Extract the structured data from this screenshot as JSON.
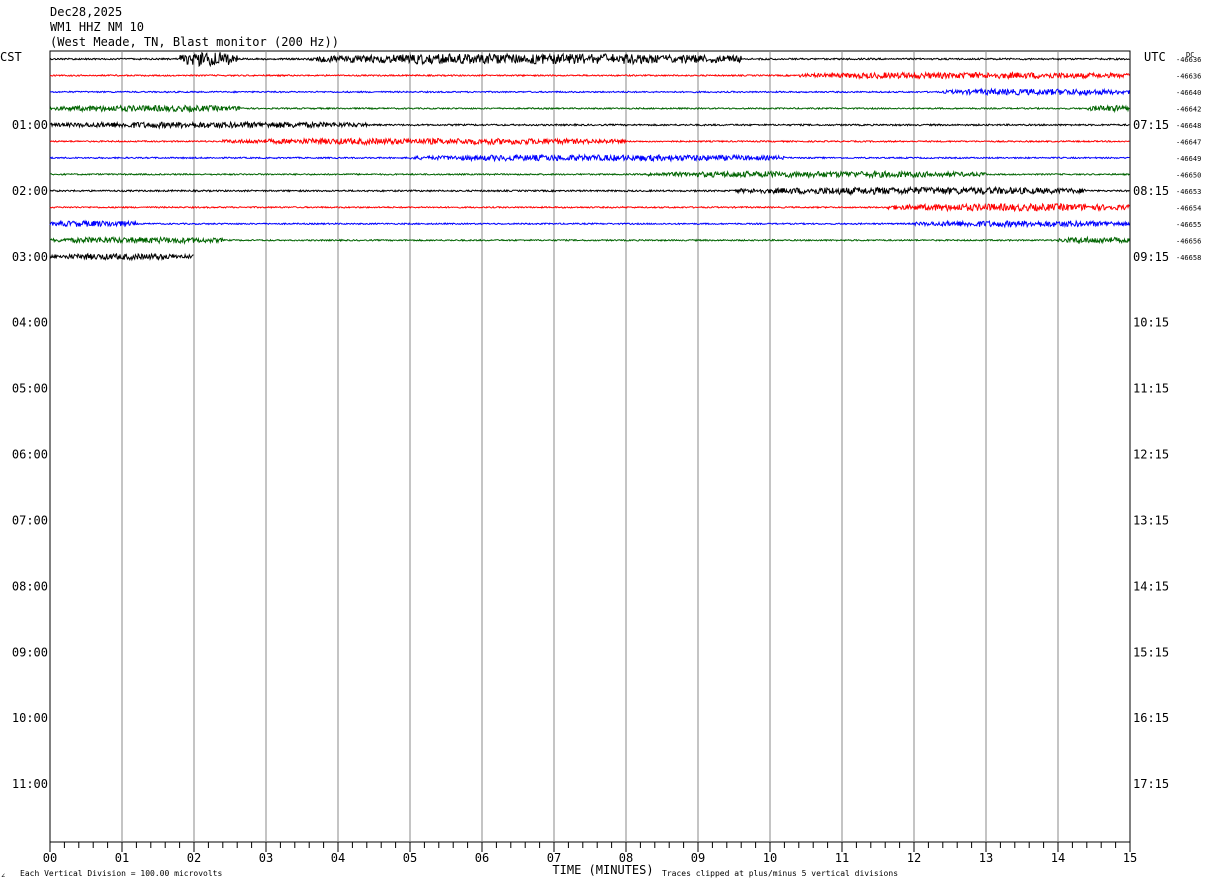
{
  "header": {
    "date": "Dec28,2025",
    "station": "WM1 HHZ NM 10",
    "location": "(West Meade, TN, Blast monitor (200 Hz))"
  },
  "labels": {
    "left_tz": "CST",
    "right_tz": "UTC",
    "dc_header": "DC",
    "xlabel": "TIME (MINUTES)",
    "scale_note": "Each Vertical Division =  100.00 microvolts",
    "clip_note": "Traces clipped at plus/minus 5 vertical divisions",
    "corner_mark": "∠"
  },
  "chart_data": {
    "type": "line",
    "title": "WM1 HHZ NM 10",
    "xlabel": "TIME (MINUTES)",
    "xlim": [
      0,
      15
    ],
    "x_ticks": [
      "00",
      "01",
      "02",
      "03",
      "04",
      "05",
      "06",
      "07",
      "08",
      "09",
      "10",
      "11",
      "12",
      "13",
      "14",
      "15"
    ],
    "row_minutes": 15,
    "total_rows": 48,
    "left_hour_labels": [
      "01:00",
      "02:00",
      "03:00",
      "04:00",
      "05:00",
      "06:00",
      "07:00",
      "08:00",
      "09:00",
      "10:00",
      "11:00"
    ],
    "right_hour_labels": [
      "07:15",
      "08:15",
      "09:15",
      "10:15",
      "11:15",
      "12:15",
      "13:15",
      "14:15",
      "15:15",
      "16:15",
      "17:15"
    ],
    "trace_colors": [
      "#000000",
      "#ff0000",
      "#0000ff",
      "#006400"
    ],
    "traces": [
      {
        "row": 0,
        "dc": "-46636",
        "end_min": 15,
        "noise": 0.8,
        "bursts": [
          [
            1.8,
            2.6,
            7
          ],
          [
            3.6,
            9.6,
            5
          ]
        ]
      },
      {
        "row": 1,
        "dc": "-46636",
        "end_min": 15,
        "noise": 0.7,
        "bursts": [
          [
            10.4,
            15,
            3
          ]
        ]
      },
      {
        "row": 2,
        "dc": "-46640",
        "end_min": 15,
        "noise": 0.7,
        "bursts": [
          [
            12.4,
            15,
            3
          ]
        ]
      },
      {
        "row": 3,
        "dc": "-46642",
        "end_min": 15,
        "noise": 0.7,
        "bursts": [
          [
            0,
            2.7,
            3
          ],
          [
            14.4,
            15,
            3
          ]
        ]
      },
      {
        "row": 4,
        "dc": "-46648",
        "end_min": 15,
        "noise": 0.8,
        "bursts": [
          [
            0,
            4.4,
            3
          ]
        ]
      },
      {
        "row": 5,
        "dc": "-46647",
        "end_min": 15,
        "noise": 0.7,
        "bursts": [
          [
            2.4,
            8.0,
            3
          ]
        ]
      },
      {
        "row": 6,
        "dc": "-46649",
        "end_min": 15,
        "noise": 0.7,
        "bursts": [
          [
            5.0,
            10.2,
            3
          ]
        ]
      },
      {
        "row": 7,
        "dc": "-46650",
        "end_min": 15,
        "noise": 0.7,
        "bursts": [
          [
            8.3,
            13.0,
            3
          ]
        ]
      },
      {
        "row": 8,
        "dc": "-46653",
        "end_min": 15,
        "noise": 0.8,
        "bursts": [
          [
            9.5,
            14.4,
            3.5
          ]
        ]
      },
      {
        "row": 9,
        "dc": "-46654",
        "end_min": 15,
        "noise": 0.7,
        "bursts": [
          [
            11.6,
            15,
            3.5
          ]
        ]
      },
      {
        "row": 10,
        "dc": "-46655",
        "end_min": 15,
        "noise": 0.7,
        "bursts": [
          [
            0,
            1.2,
            3
          ],
          [
            12.0,
            15,
            3
          ]
        ]
      },
      {
        "row": 11,
        "dc": "-46656",
        "end_min": 15,
        "noise": 0.7,
        "bursts": [
          [
            0,
            2.4,
            3
          ],
          [
            14.0,
            15,
            3
          ]
        ]
      },
      {
        "row": 12,
        "dc": "-46658",
        "end_min": 2.0,
        "noise": 0.8,
        "bursts": [
          [
            0,
            2.0,
            3
          ]
        ]
      }
    ]
  }
}
